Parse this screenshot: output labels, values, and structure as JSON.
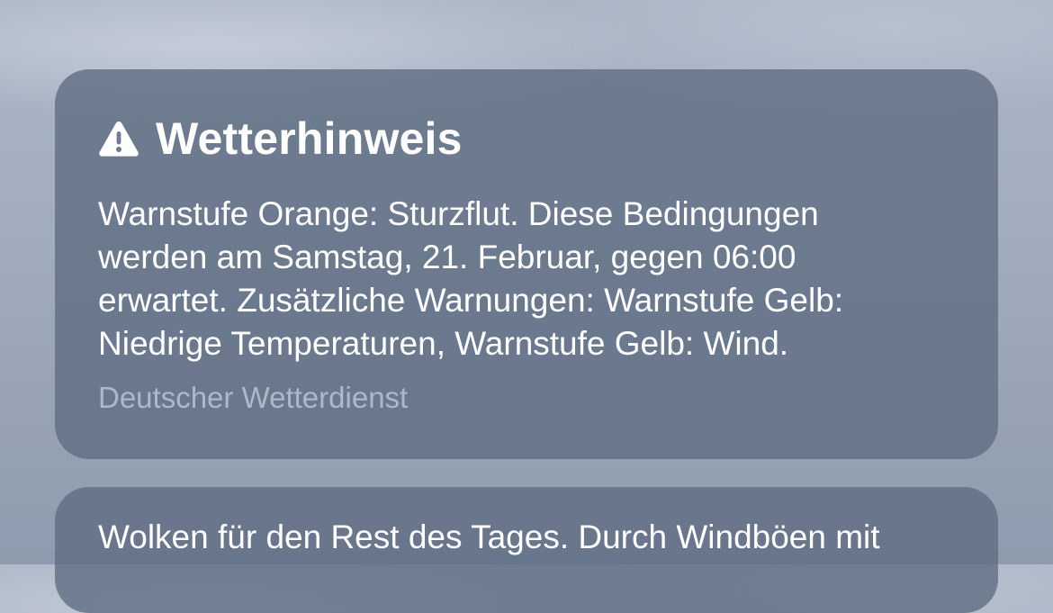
{
  "notifications": [
    {
      "icon": "warning-icon",
      "title": "Wetterhinweis",
      "body": "Warnstufe Orange: Sturzflut. Diese Bedingungen\nwerden am Samstag, 21. Februar, gegen 06:00\nerwartet. Zusätzliche Warnungen: Warnstufe Gelb:\nNiedrige Temperaturen, Warnstufe Gelb: Wind.",
      "source": "Deutscher Wetterdienst"
    },
    {
      "body": "Wolken für den Rest des Tages. Durch Windböen mit"
    }
  ],
  "colors": {
    "card_background": "#5e6b82",
    "text_primary": "#ffffff",
    "text_secondary": "#aeb8c9"
  }
}
